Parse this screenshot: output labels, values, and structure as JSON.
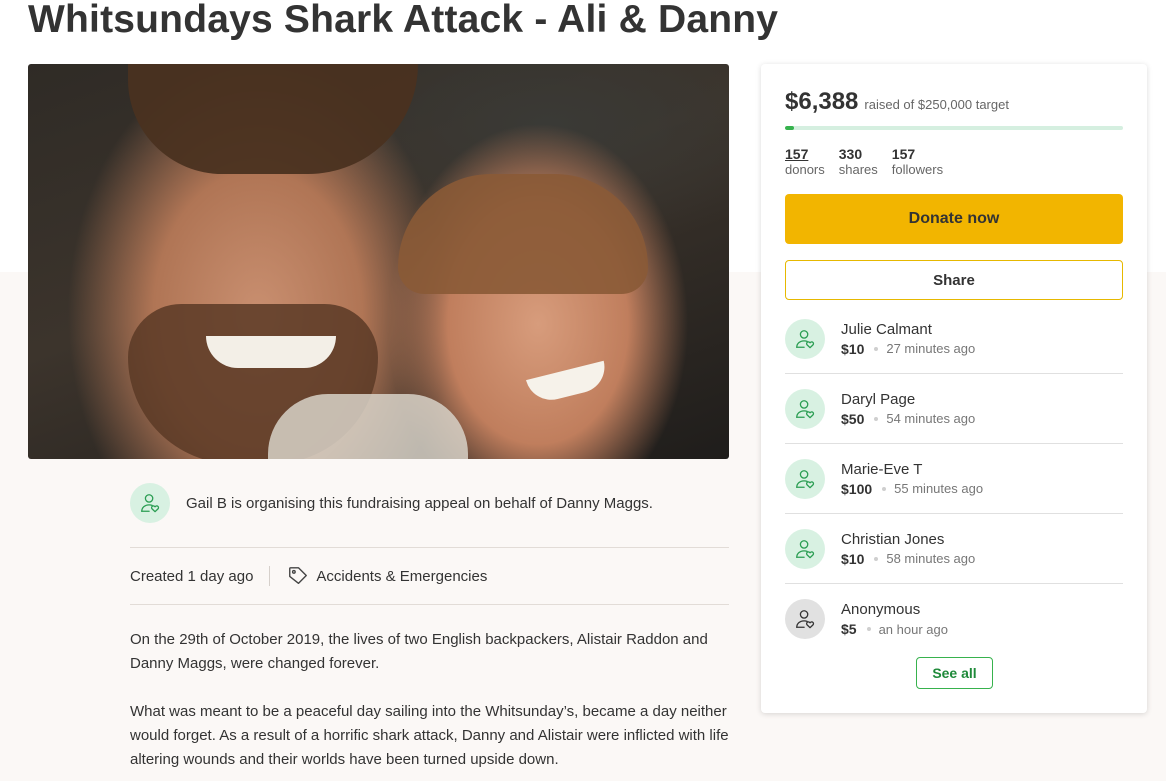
{
  "campaign": {
    "title": "Whitsundays Shark Attack - Ali & Danny",
    "photo_alt": "Selfie of Ali and Danny smiling",
    "organiser_text": "Gail B is organising this fundraising appeal on behalf of Danny Maggs.",
    "created": "Created 1 day ago",
    "category": "Accidents & Emergencies",
    "story": [
      "On the 29th of October 2019, the lives of two English backpackers, Alistair Raddon and Danny Maggs, were changed forever.",
      "What was meant to be a peaceful day sailing into the Whitsunday’s, became a day neither would forget. As a result of a horrific shark attack, Danny and Alistair were inflicted with life altering wounds and their worlds have been turned upside down."
    ]
  },
  "sidebar": {
    "raised_amount": "$6,388",
    "raised_target": "raised of $250,000 target",
    "progress_fraction": 0.0256,
    "stats": [
      {
        "value": "157",
        "label": "donors"
      },
      {
        "value": "330",
        "label": "shares"
      },
      {
        "value": "157",
        "label": "followers"
      }
    ],
    "donate_label": "Donate now",
    "share_label": "Share",
    "see_all_label": "See all",
    "donations": [
      {
        "name": "Julie Calmant",
        "amount": "$10",
        "time": "27 minutes ago",
        "avatar": "green"
      },
      {
        "name": "Daryl Page",
        "amount": "$50",
        "time": "54 minutes ago",
        "avatar": "green"
      },
      {
        "name": "Marie-Eve T",
        "amount": "$100",
        "time": "55 minutes ago",
        "avatar": "green"
      },
      {
        "name": "Christian Jones",
        "amount": "$10",
        "time": "58 minutes ago",
        "avatar": "green"
      },
      {
        "name": "Anonymous",
        "amount": "$5",
        "time": "an hour ago",
        "avatar": "grey"
      }
    ]
  },
  "colors": {
    "accent_yellow": "#f2b500",
    "accent_green": "#37b24d",
    "progress_track": "#d5efe0",
    "page_background": "#fbf8f6"
  },
  "icons": {
    "organiser": "user-heart-icon",
    "category": "tag-icon",
    "donor": "user-heart-icon"
  }
}
